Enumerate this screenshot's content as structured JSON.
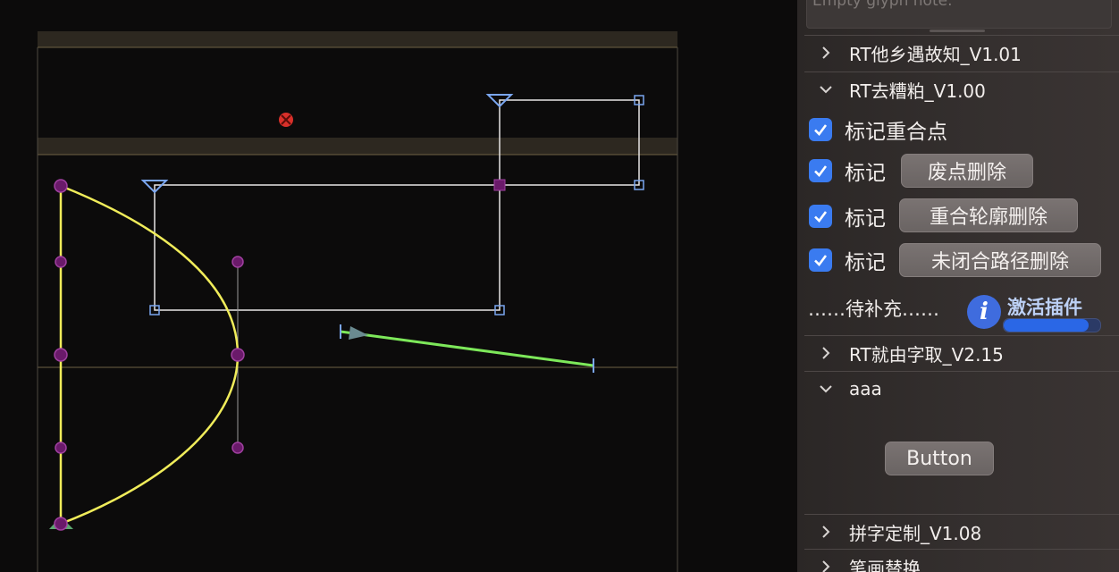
{
  "panel": {
    "glyph_note_placeholder": "Empty glyph note.",
    "sections": [
      {
        "label": "RT他乡遇故知_V1.01",
        "expanded": false
      },
      {
        "label": "RT去糟粕_V1.00",
        "expanded": true
      },
      {
        "label": "RT就由字取_V2.15",
        "expanded": false
      },
      {
        "label": "aaa",
        "expanded": true
      },
      {
        "label": "拼字定制_V1.08",
        "expanded": false
      },
      {
        "label": "笔画替换",
        "expanded": false
      }
    ],
    "cleanup": {
      "mark_overlap_label": "标记重合点",
      "mark_label": "标记",
      "stray_delete_button": "废点删除",
      "overlap_delete_button": "重合轮廓删除",
      "open_path_delete_button": "未闭合路径删除",
      "pending_text": "……待补充……",
      "activate_label": "激活插件",
      "activate_progress": 0.88,
      "checkboxes_checked": [
        true,
        true,
        true,
        true
      ]
    },
    "aaa": {
      "button_label": "Button"
    }
  },
  "colors": {
    "accent": "#3a7bf0",
    "path_yellow": "#f0ec5a",
    "guide_green": "#7de85a",
    "node_purple": "#6a1a6a",
    "handle_blue": "#7aa6f0"
  }
}
